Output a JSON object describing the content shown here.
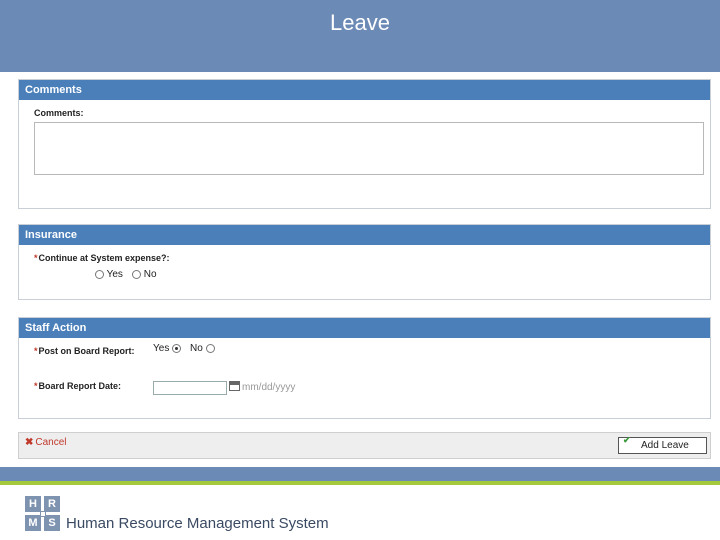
{
  "header": {
    "title": "Leave"
  },
  "comments": {
    "section_title": "Comments",
    "label": "Comments:",
    "value": ""
  },
  "insurance": {
    "section_title": "Insurance",
    "label": "Continue at System expense?:",
    "options": [
      "Yes",
      "No"
    ],
    "selected": null
  },
  "staff_action": {
    "section_title": "Staff Action",
    "post_label": "Post on Board Report:",
    "post_options": [
      "Yes",
      "No"
    ],
    "post_selected": "Yes",
    "date_label": "Board Report Date:",
    "date_value": "",
    "date_placeholder": "mm/dd/yyyy"
  },
  "actions": {
    "cancel_label": "Cancel",
    "add_label": "Add Leave"
  },
  "footer": {
    "logo_letters": [
      "H",
      "R",
      "M",
      "S"
    ],
    "system_name": "Human Resource Management System"
  },
  "colors": {
    "banner": "#6b8ab5",
    "panel_header": "#4a7fba",
    "accent_green": "#a4c93a",
    "required": "#c0392b"
  }
}
